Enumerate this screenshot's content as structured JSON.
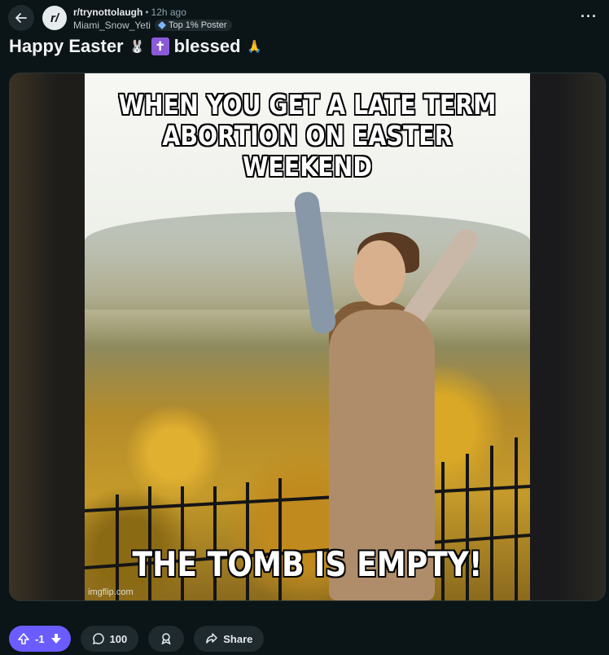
{
  "post": {
    "subreddit": "r/trynottolaugh",
    "time_ago": "12h ago",
    "author": "Miami_Snow_Yeti",
    "badge": "Top 1% Poster",
    "title_part1": "Happy Easter",
    "title_part2": "blessed"
  },
  "media": {
    "top_text": "WHEN YOU GET A LATE TERM ABORTION ON EASTER WEEKEND",
    "bottom_text": "THE TOMB IS EMPTY!",
    "watermark": "imgflip.com"
  },
  "actions": {
    "vote_count": "-1",
    "comment_count": "100",
    "share_label": "Share"
  },
  "colors": {
    "background": "#0b1416",
    "vote_accent": "#6a5cff"
  },
  "icons": [
    "back-arrow-icon",
    "more-icon",
    "rabbit-emoji-icon",
    "cross-emoji-icon",
    "praying-hands-emoji-icon",
    "upvote-icon",
    "downvote-icon",
    "comment-icon",
    "award-icon",
    "share-icon"
  ]
}
